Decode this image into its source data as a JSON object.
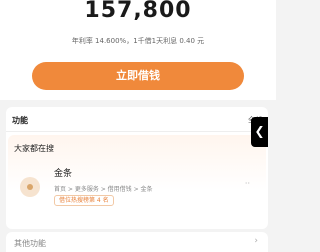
{
  "loan": {
    "amount": "157,800",
    "rate_text": "年利率 14.600%，1千借1天利息 0.40 元",
    "borrow_label": "立即借钱"
  },
  "functions": {
    "title": "功能",
    "all_label": "全部",
    "popular": {
      "title": "大家都在搜",
      "items": [
        {
          "name": "金条",
          "path": "首页 > 更多服务 > 借用借钱 > 金条",
          "tag": "借位热搜榜第 4 名",
          "icon": "gold-bar-icon"
        }
      ]
    }
  },
  "other": {
    "label": "其他功能"
  },
  "side_tab": {
    "glyph": "❮"
  }
}
